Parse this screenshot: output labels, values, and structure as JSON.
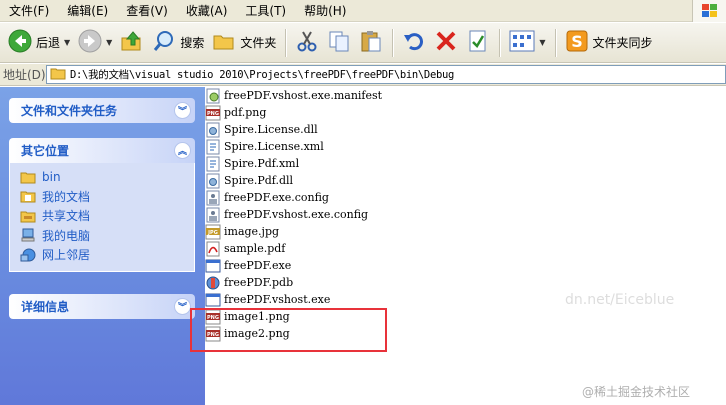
{
  "menu": {
    "items": [
      "文件(F)",
      "编辑(E)",
      "查看(V)",
      "收藏(A)",
      "工具(T)",
      "帮助(H)"
    ]
  },
  "toolbar": {
    "back_label": "后退",
    "search_label": "搜索",
    "folders_label": "文件夹",
    "sync_label": "文件夹同步"
  },
  "address": {
    "label": "地址(D)",
    "path": "D:\\我的文档\\visual studio 2010\\Projects\\freePDF\\freePDF\\bin\\Debug"
  },
  "sidebar": {
    "tasks_title": "文件和文件夹任务",
    "other_title": "其它位置",
    "other_items": [
      "bin",
      "我的文档",
      "共享文档",
      "我的电脑",
      "网上邻居"
    ],
    "details_title": "详细信息"
  },
  "files": [
    {
      "name": "freePDF.vshost.exe.manifest",
      "icon": "manifest-file-icon"
    },
    {
      "name": "pdf.png",
      "icon": "png-file-icon"
    },
    {
      "name": "Spire.License.dll",
      "icon": "dll-file-icon"
    },
    {
      "name": "Spire.License.xml",
      "icon": "xml-file-icon"
    },
    {
      "name": "Spire.Pdf.xml",
      "icon": "xml-file-icon"
    },
    {
      "name": "Spire.Pdf.dll",
      "icon": "dll-file-icon"
    },
    {
      "name": "freePDF.exe.config",
      "icon": "config-file-icon"
    },
    {
      "name": "freePDF.vshost.exe.config",
      "icon": "config-file-icon"
    },
    {
      "name": "image.jpg",
      "icon": "jpg-file-icon"
    },
    {
      "name": "sample.pdf",
      "icon": "pdf-file-icon"
    },
    {
      "name": "freePDF.exe",
      "icon": "exe-file-icon"
    },
    {
      "name": "freePDF.pdb",
      "icon": "pdb-file-icon"
    },
    {
      "name": "freePDF.vshost.exe",
      "icon": "exe-file-icon"
    },
    {
      "name": "image1.png",
      "icon": "png-file-icon"
    },
    {
      "name": "image2.png",
      "icon": "png-file-icon"
    }
  ],
  "watermarks": {
    "blog": "dn.net/Eiceblue",
    "community": "@稀土掘金技术社区"
  },
  "colors": {
    "sidebar_bg": "#6a8ee0",
    "link": "#215dc6",
    "highlight": "#e8323a",
    "menubar": "#ece9d8"
  }
}
